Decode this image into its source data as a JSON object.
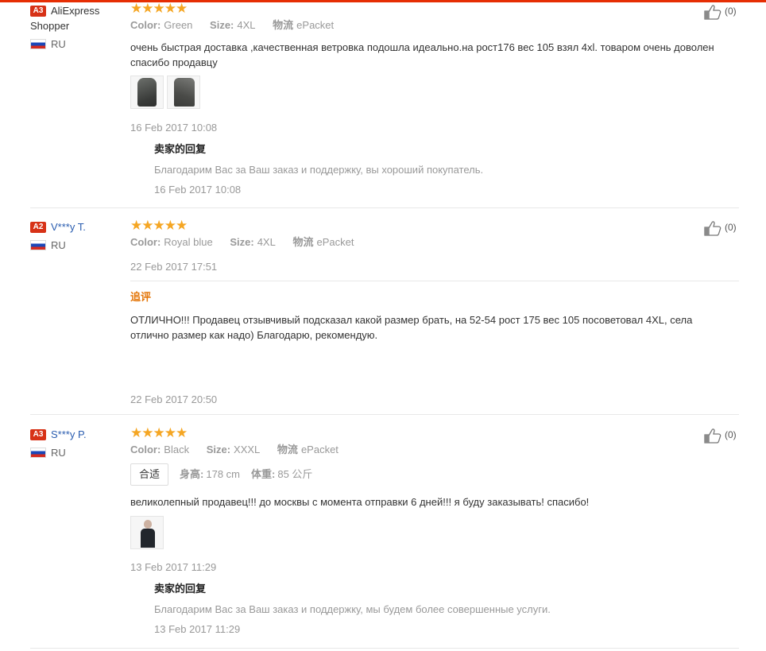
{
  "reviews": [
    {
      "level": "A3",
      "user": "AliExpress Shopper",
      "country": "RU",
      "stars": 5,
      "attrs": [
        {
          "key": "Color:",
          "value": "Green"
        },
        {
          "key": "Size:",
          "value": "4XL"
        },
        {
          "key": "物流",
          "value": "ePacket"
        }
      ],
      "text": "очень быстрая доставка ,качественная ветровка подошла идеально.на рост176 вес 105 взял 4xl. товаром очень доволен спасибо продавцу",
      "date": "16 Feb 2017 10:08",
      "reply": {
        "title": "卖家的回复",
        "text": "Благодарим Вас за Ваш заказ и поддержку, вы хороший покупатель.",
        "date": "16 Feb 2017 10:08"
      },
      "helpful_count": "(0)"
    },
    {
      "level": "A2",
      "user": "V***y T.",
      "country": "RU",
      "stars": 5,
      "attrs": [
        {
          "key": "Color:",
          "value": "Royal blue"
        },
        {
          "key": "Size:",
          "value": "4XL"
        },
        {
          "key": "物流",
          "value": "ePacket"
        }
      ],
      "date": "22 Feb 2017 17:51",
      "additional": {
        "title": "追评",
        "text": "ОТЛИЧНО!!! Продавец отзывчивый подсказал какой размер брать, на 52-54 рост 175 вес 105 посоветовал 4XL, села отлично размер как надо) Благодарю, рекомендую.",
        "date": "22 Feb 2017 20:50"
      },
      "helpful_count": "(0)"
    },
    {
      "level": "A3",
      "user": "S***y P.",
      "country": "RU",
      "stars": 5,
      "attrs": [
        {
          "key": "Color:",
          "value": "Black"
        },
        {
          "key": "Size:",
          "value": "XXXL"
        },
        {
          "key": "物流",
          "value": "ePacket"
        }
      ],
      "fit": "合适",
      "measures": [
        {
          "key": "身高:",
          "value": "178 cm"
        },
        {
          "key": "体重:",
          "value": "85 公斤"
        }
      ],
      "text": "великолепный продавец!!! до москвы с момента отправки 6 дней!!! я буду заказывать! спасибо!",
      "date": "13 Feb 2017 11:29",
      "reply": {
        "title": "卖家的回复",
        "text": "Благодарим Вас за Ваш заказ и поддержку, мы будем более совершенные услуги.",
        "date": "13 Feb 2017 11:29"
      },
      "helpful_count": "(0)"
    }
  ],
  "colors": {
    "accent": "#e62e04",
    "badge": "#d73217",
    "star": "#f5a623",
    "link": "#2a5db0",
    "additional_title": "#e4770a"
  },
  "icons": {
    "helpful": "thumbs-up-icon",
    "star": "star-icon",
    "flag": "russia-flag-icon"
  }
}
